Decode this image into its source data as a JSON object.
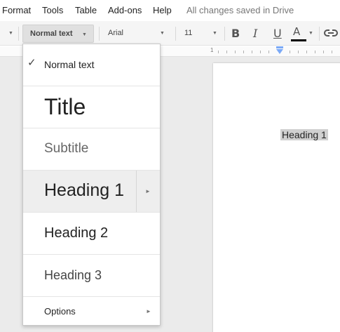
{
  "menubar": {
    "items": [
      "Format",
      "Tools",
      "Table",
      "Add-ons",
      "Help"
    ],
    "status": "All changes saved in Drive"
  },
  "toolbar": {
    "style_value": "Normal text",
    "font_value": "Arial",
    "size_value": "11",
    "bold_glyph": "B",
    "italic_glyph": "I",
    "underline_glyph": "U",
    "text_color_glyph": "A",
    "text_color": "#000000",
    "icons": [
      "bold-icon",
      "italic-icon",
      "underline-icon",
      "text-color-icon",
      "link-icon"
    ]
  },
  "ruler": {
    "number": "1"
  },
  "document": {
    "selected_text": "Heading 1"
  },
  "style_menu": {
    "items": [
      {
        "label": "Normal text",
        "checked": true
      },
      {
        "label": "Title"
      },
      {
        "label": "Subtitle"
      },
      {
        "label": "Heading 1",
        "highlighted": true,
        "has_submenu": true
      },
      {
        "label": "Heading 2"
      },
      {
        "label": "Heading 3"
      },
      {
        "label": "Options",
        "has_submenu": true
      }
    ],
    "submenu_arrow": "►",
    "check_glyph": "✓"
  },
  "colors": {
    "toolbar_bg": "#f5f5f5",
    "hover_bg": "#eeeeee",
    "ruler_marker": "#7baaf7",
    "status_text": "#777777"
  }
}
